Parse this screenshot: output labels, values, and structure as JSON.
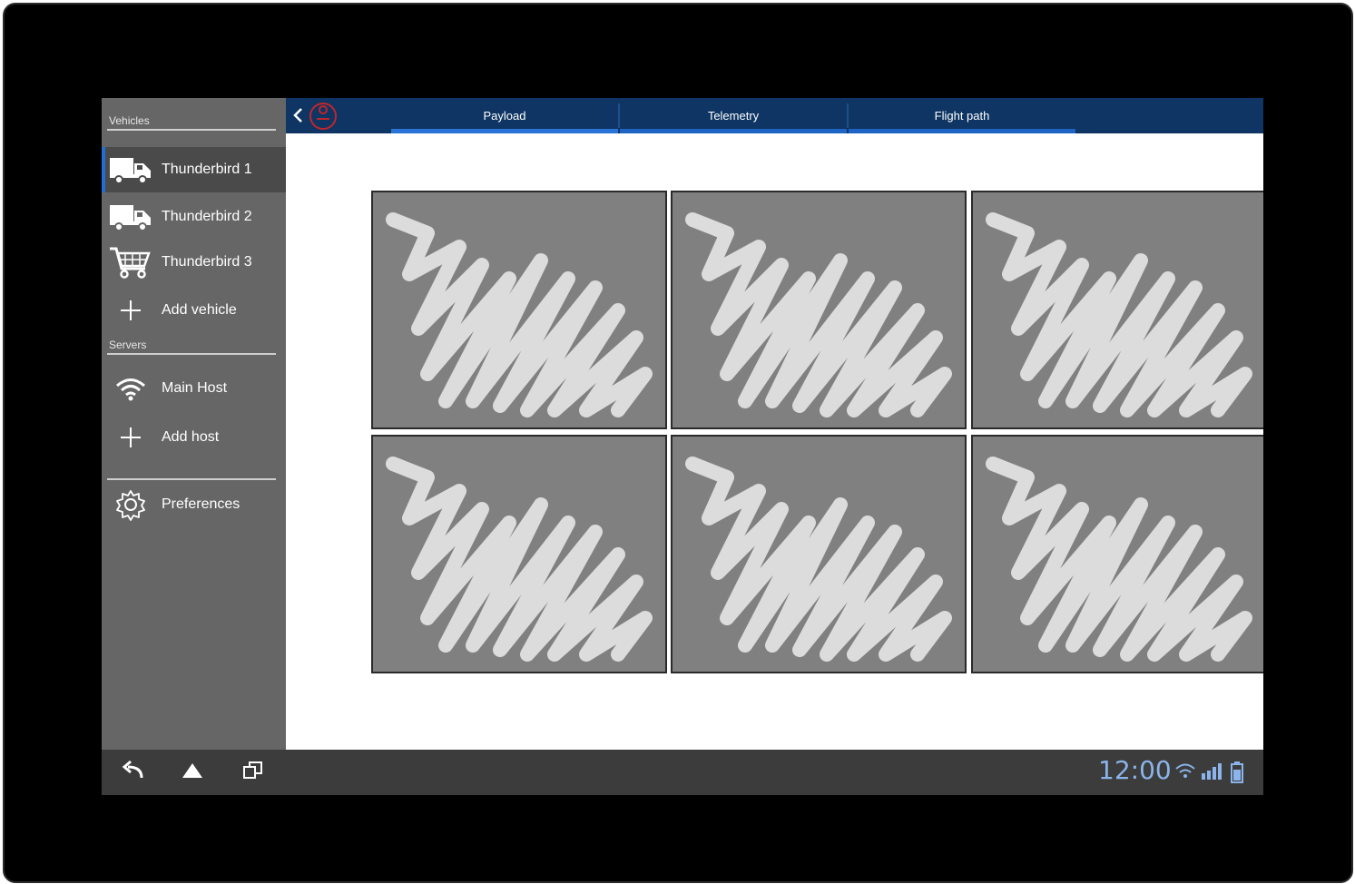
{
  "sidebar": {
    "vehicles_label": "Vehicles",
    "servers_label": "Servers",
    "vehicles": [
      {
        "label": "Thunderbird 1",
        "icon": "truck-icon",
        "active": true
      },
      {
        "label": "Thunderbird 2",
        "icon": "truck-icon",
        "active": false
      },
      {
        "label": "Thunderbird 3",
        "icon": "cart-icon",
        "active": false
      }
    ],
    "add_vehicle": "Add vehicle",
    "hosts": [
      {
        "label": "Main Host",
        "icon": "wifi-icon"
      }
    ],
    "add_host": "Add host",
    "preferences": "Preferences"
  },
  "topbar": {
    "tabs": [
      {
        "label": "Payload",
        "active": true
      },
      {
        "label": "Telemetry",
        "active": false
      },
      {
        "label": "Flight path",
        "active": false
      }
    ]
  },
  "content": {
    "tiles": [
      "image-placeholder",
      "image-placeholder",
      "image-placeholder",
      "image-placeholder",
      "image-placeholder",
      "image-placeholder"
    ]
  },
  "statusbar": {
    "time": "12:00"
  },
  "colors": {
    "topbar": "#0e3563",
    "tab_underline": "#2a74d8",
    "sidebar": "#666666",
    "clock": "#8ab4ea"
  }
}
